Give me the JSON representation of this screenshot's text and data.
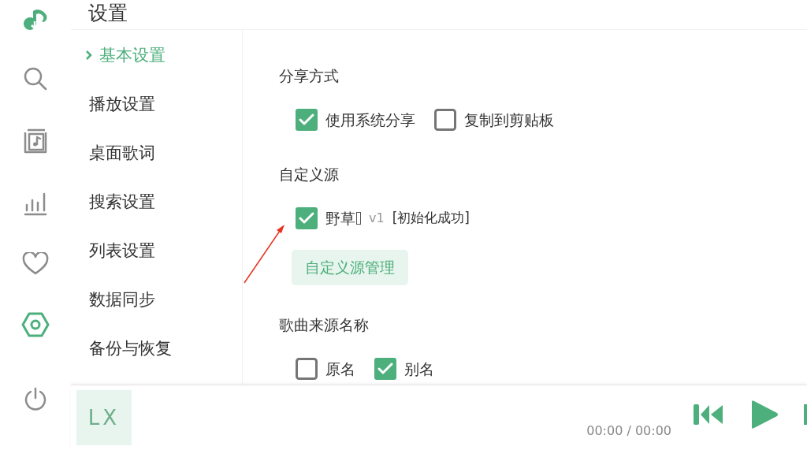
{
  "header": {
    "title": "设置"
  },
  "rail": [
    {
      "kind": "search",
      "selected": false
    },
    {
      "kind": "songlist",
      "selected": false
    },
    {
      "kind": "chart",
      "selected": false
    },
    {
      "kind": "heart",
      "selected": false
    },
    {
      "kind": "settings",
      "selected": true
    }
  ],
  "nav": [
    {
      "label": "基本设置",
      "selected": true
    },
    {
      "label": "播放设置",
      "selected": false
    },
    {
      "label": "桌面歌词",
      "selected": false
    },
    {
      "label": "搜索设置",
      "selected": false
    },
    {
      "label": "列表设置",
      "selected": false
    },
    {
      "label": "数据同步",
      "selected": false
    },
    {
      "label": "备份与恢复",
      "selected": false
    }
  ],
  "sections": [
    {
      "title": "分享方式",
      "options": [
        {
          "label": "使用系统分享",
          "checked": true
        },
        {
          "label": "复制到剪贴板",
          "checked": false
        }
      ]
    },
    {
      "title": "自定义源",
      "source": {
        "name": "野草",
        "version": "v1",
        "status": "[初始化成功]",
        "checked": true
      },
      "button": "自定义源管理"
    },
    {
      "title": "歌曲来源名称",
      "options": [
        {
          "label": "原名",
          "checked": false
        },
        {
          "label": "别名",
          "checked": true
        }
      ]
    }
  ],
  "player": {
    "cover": "LX",
    "time": "00:00 / 00:00"
  }
}
